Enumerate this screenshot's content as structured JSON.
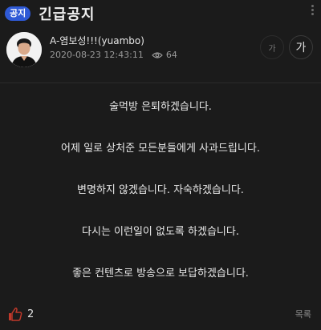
{
  "header": {
    "badge": "공지",
    "title": "긴급공지"
  },
  "post": {
    "author": "A-염보성!!!(yuambo)",
    "datetime": "2020-08-23 12:43:11",
    "views": "64",
    "font_small_label": "가",
    "font_large_label": "가"
  },
  "content": {
    "lines": [
      "술먹방 은퇴하겠습니다.",
      "어제 일로 상처준 모든분들에게 사과드립니다.",
      "변명하지 않겠습니다. 자숙하겠습니다.",
      "다시는 이런일이 없도록 하겠습니다.",
      "좋은 컨텐츠로 방송으로 보답하겠습니다."
    ]
  },
  "footer": {
    "likes": "2",
    "list_label": "목록"
  },
  "colors": {
    "background": "#1b1b1b",
    "badge": "#2f5ad6",
    "like_icon": "#c0392b"
  },
  "icons": {
    "more": "more-vertical-icon",
    "views": "eye-icon",
    "like": "thumbs-up-icon"
  }
}
